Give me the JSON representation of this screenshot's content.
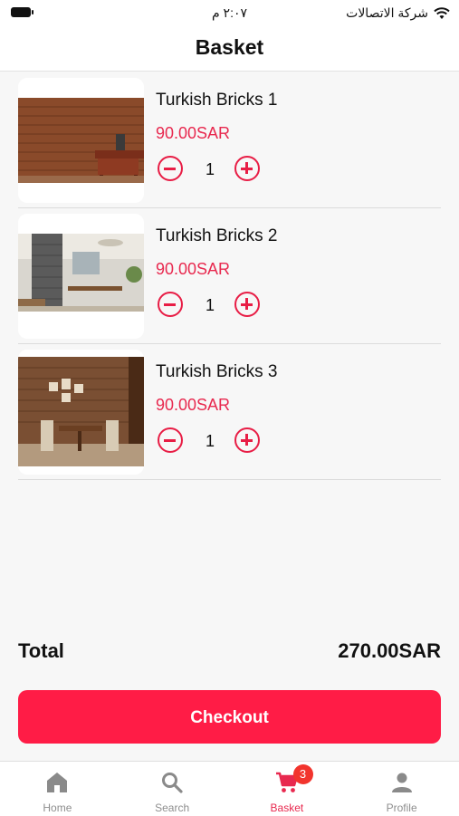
{
  "status_bar": {
    "carrier": "شركة الاتصالات",
    "time": "٢:٠٧ م"
  },
  "header": {
    "title": "Basket"
  },
  "items": [
    {
      "name": "Turkish Bricks 1",
      "price": "90.00SAR",
      "quantity": "1"
    },
    {
      "name": "Turkish Bricks 2",
      "price": "90.00SAR",
      "quantity": "1"
    },
    {
      "name": "Turkish Bricks 3",
      "price": "90.00SAR",
      "quantity": "1"
    }
  ],
  "summary": {
    "total_label": "Total",
    "total_value": "270.00SAR"
  },
  "checkout_label": "Checkout",
  "tabs": [
    {
      "label": "Home",
      "icon": "home-icon"
    },
    {
      "label": "Search",
      "icon": "search-icon"
    },
    {
      "label": "Basket",
      "icon": "cart-icon",
      "badge": "3",
      "active": true
    },
    {
      "label": "Profile",
      "icon": "user-icon"
    }
  ],
  "colors": {
    "accent": "#ff1c46",
    "price": "#e8294f",
    "badge": "#f2342d"
  }
}
